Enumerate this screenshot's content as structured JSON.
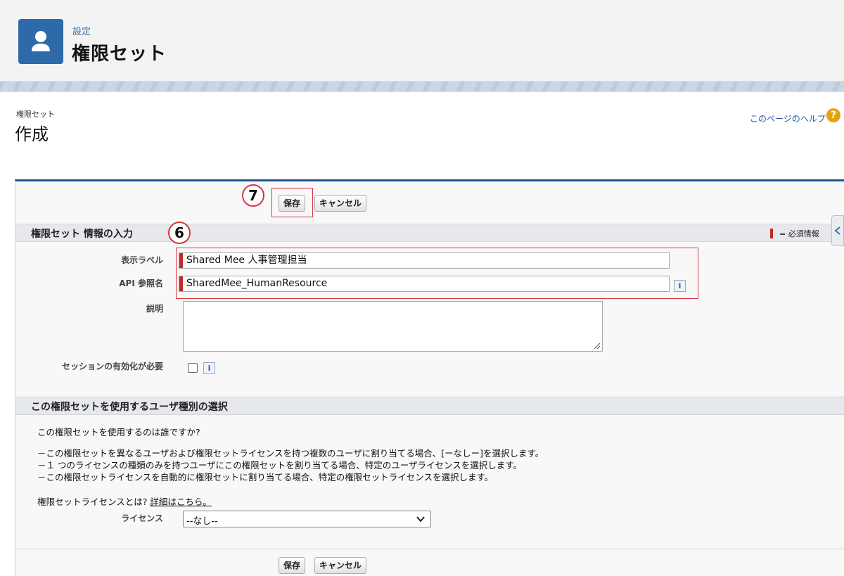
{
  "header": {
    "breadcrumb": "設定",
    "title": "権限セット",
    "icon": "user-icon"
  },
  "page": {
    "sub_label": "権限セット",
    "sub_title": "作成",
    "help_link": "このページのヘルプ",
    "help_icon": "?"
  },
  "toolbar": {
    "save_label": "保存",
    "cancel_label": "キャンセル"
  },
  "annotations": {
    "step7": "7",
    "step6": "6"
  },
  "section1": {
    "title": "権限セット 情報の入力",
    "required_note": "= 必須情報"
  },
  "fields": {
    "label_label": "表示ラベル",
    "label_value": "Shared Mee 人事管理担当",
    "api_label": "API 参照名",
    "api_value": "SharedMee_HumanResource",
    "description_label": "説明",
    "description_value": "",
    "session_label": "セッションの有効化が必要",
    "info": "i"
  },
  "section2": {
    "title": "この権限セットを使用するユーザ種別の選択",
    "question": "この権限セットを使用するのは誰ですか?",
    "line1": "－この権限セットを異なるユーザおよび権限セットライセンスを持つ複数のユーザに割り当てる場合、[ーなしー]を選択します。",
    "line2": "－１ つのライセンスの種類のみを持つユーザにこの権限セットを割り当てる場合、特定のユーザライセンスを選択します。",
    "line3": "－この権限セットライセンスを自動的に権限セットに割り当てる場合、特定の権限セットライセンスを選択します。",
    "what_is_prefix": "権限セットライセンスとは? ",
    "what_is_link": "詳細はこちら。",
    "license_label": "ライセンス",
    "license_value": "--なし--"
  },
  "colors": {
    "brand": "#2e6aa8",
    "required": "#c02a2a",
    "annotation": "#d9363e"
  }
}
